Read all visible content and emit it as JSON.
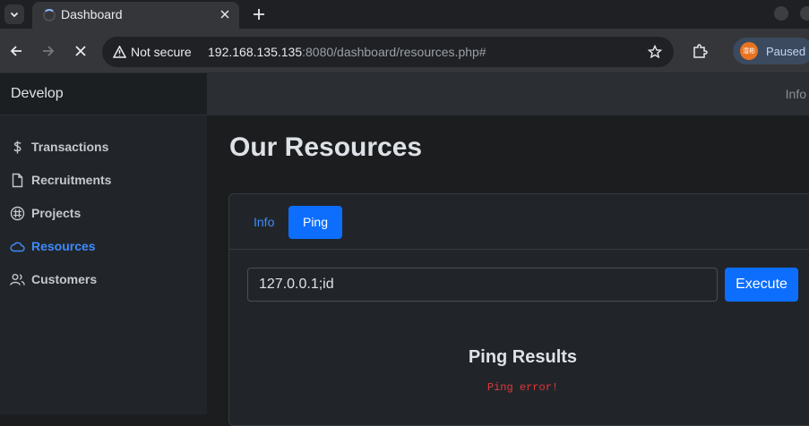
{
  "browser": {
    "tab": {
      "title": "Dashboard",
      "loading": true
    },
    "security_label": "Not secure",
    "url": {
      "host": "192.168.135.135",
      "rest": ":8080/dashboard/resources.php#"
    },
    "profile": {
      "avatar_text": "澧彬",
      "status": "Paused"
    }
  },
  "sidebar": {
    "brand": "Develop",
    "items": [
      {
        "label": "Transactions",
        "icon": "dollar-icon",
        "active": false
      },
      {
        "label": "Recruitments",
        "icon": "file-icon",
        "active": false
      },
      {
        "label": "Projects",
        "icon": "slack-icon",
        "active": false
      },
      {
        "label": "Resources",
        "icon": "cloud-icon",
        "active": true
      },
      {
        "label": "Customers",
        "icon": "people-icon",
        "active": false
      }
    ]
  },
  "topbar": {
    "info": "Info"
  },
  "main": {
    "title": "Our Resources",
    "tabs": [
      {
        "label": "Info",
        "active": false
      },
      {
        "label": "Ping",
        "active": true
      }
    ],
    "command": {
      "value": "127.0.0.1;id"
    },
    "execute_label": "Execute",
    "results_title": "Ping Results",
    "results_error": "Ping error!"
  },
  "colors": {
    "accent": "#0d6efd",
    "link": "#3d8bfd",
    "error": "#e03a3a"
  }
}
